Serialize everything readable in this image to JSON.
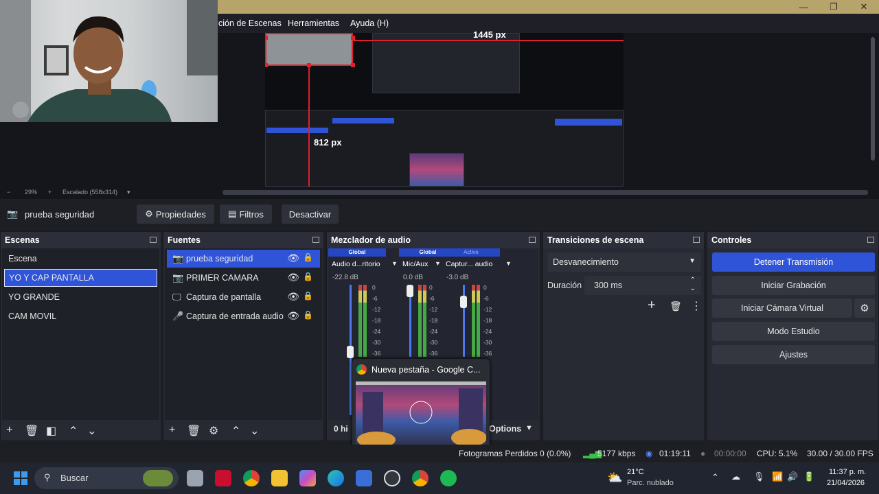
{
  "window": {
    "minimize": "—",
    "maximize": "❐",
    "close": "✕"
  },
  "menu": [
    "ción de Escenas",
    "Herramientas",
    "Ayuda (H)"
  ],
  "preview": {
    "width_label": "1445 px",
    "height_label": "812 px"
  },
  "zoom": {
    "minus": "−",
    "zoom": "29%",
    "plus": "+",
    "scale": "Escalado (558x314)",
    "dropdown": "▾"
  },
  "source_toolbar": {
    "source_name": "prueba seguridad",
    "properties": "Propiedades",
    "filters": "Filtros",
    "deactivate": "Desactivar"
  },
  "scenes": {
    "title": "Escenas",
    "items": [
      "Escena",
      "YO Y CAP PANTALLA",
      "YO GRANDE",
      "CAM MOVIL"
    ],
    "selected": 1
  },
  "sources": {
    "title": "Fuentes",
    "items": [
      {
        "label": "prueba seguridad",
        "icon": "camera-icon",
        "glyph": "📷"
      },
      {
        "label": "PRIMER CAMARA",
        "icon": "camera-icon",
        "glyph": "📷"
      },
      {
        "label": "Captura de pantalla",
        "icon": "monitor-icon",
        "glyph": "🖵"
      },
      {
        "label": "Captura de entrada audio",
        "icon": "microphone-icon",
        "glyph": "🎤"
      }
    ]
  },
  "mixer": {
    "title": "Mezclador de audio",
    "channels": [
      {
        "header": "Global",
        "name": "Audio d...ritorio",
        "db": "-22.8 dB",
        "level": 0.15
      },
      {
        "header": "Global",
        "name": "Mic/Aux",
        "db": "0.0 dB",
        "level": 1.0
      },
      {
        "header": "Active",
        "name": "Captur... audio",
        "db": "-3.0 dB",
        "level": 0.85
      }
    ],
    "ticks": [
      "0",
      "-6",
      "-12",
      "-18",
      "-24",
      "-30",
      "-36"
    ],
    "footer_left": "0 hi",
    "footer_right": "Options"
  },
  "popup": {
    "title": "Nueva pestaña - Google C..."
  },
  "transitions": {
    "title": "Transiciones de escena",
    "transition": "Desvanecimiento",
    "duration_label": "Duración",
    "duration_value": "300 ms"
  },
  "controls": {
    "title": "Controles",
    "stop_stream": "Detener Transmisión",
    "start_recording": "Iniciar Grabación",
    "start_virtual_cam": "Iniciar Cámara Virtual",
    "studio_mode": "Modo Estudio",
    "settings": "Ajustes"
  },
  "status": {
    "dropped": "Fotogramas Perdidos 0 (0.0%)",
    "bitrate": "5177 kbps",
    "stream_time": "01:19:11",
    "rec_time": "00:00:00",
    "cpu": "CPU: 5.1%",
    "fps": "30.00 / 30.00 FPS"
  },
  "taskbar": {
    "search": "Buscar",
    "weather_temp": "21°C",
    "weather_desc": "Parc. nublado",
    "time": "11:37 p. m.",
    "date": "21/04/2026"
  },
  "colors": {
    "accent": "#2f54d8",
    "red_guides": "#e0202a",
    "taskbar": "#202530"
  }
}
